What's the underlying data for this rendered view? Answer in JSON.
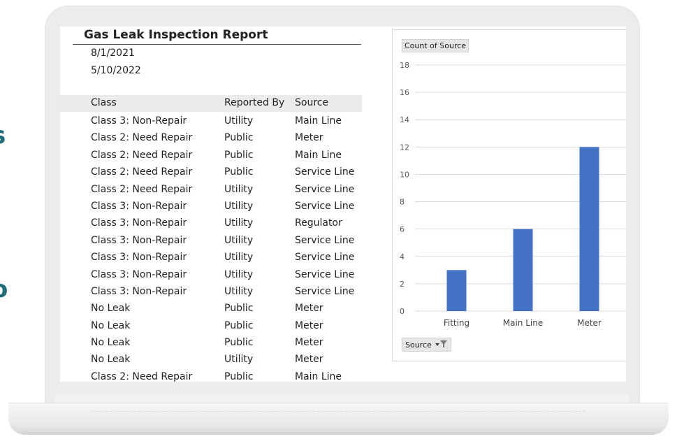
{
  "report": {
    "title": "Gas Leak Inspection Report",
    "date_start": "8/1/2021",
    "date_end": "5/10/2022",
    "columns": [
      "Class",
      "Reported By",
      "Source"
    ],
    "rows": [
      [
        "Class 3: Non-Repair",
        "Utility",
        "Main Line"
      ],
      [
        "Class 2: Need Repair",
        "Public",
        "Meter"
      ],
      [
        "Class 2: Need Repair",
        "Public",
        "Main Line"
      ],
      [
        "Class 2: Need Repair",
        "Public",
        "Service Line"
      ],
      [
        "Class 2: Need Repair",
        "Utility",
        "Service Line"
      ],
      [
        "Class 3: Non-Repair",
        "Utility",
        "Service Line"
      ],
      [
        "Class 3: Non-Repair",
        "Utility",
        "Regulator"
      ],
      [
        "Class 3: Non-Repair",
        "Utility",
        "Service Line"
      ],
      [
        "Class 3: Non-Repair",
        "Utility",
        "Service Line"
      ],
      [
        "Class 3: Non-Repair",
        "Utility",
        "Service Line"
      ],
      [
        "Class 3: Non-Repair",
        "Utility",
        "Service Line"
      ],
      [
        "No Leak",
        "Public",
        "Meter"
      ],
      [
        "No Leak",
        "Public",
        "Meter"
      ],
      [
        "No Leak",
        "Public",
        "Meter"
      ],
      [
        "No Leak",
        "Utility",
        "Meter"
      ],
      [
        "Class 2: Need Repair",
        "Public",
        "Main Line"
      ]
    ]
  },
  "chart_panel": {
    "value_field_label": "Count of Source",
    "axis_field_label": "Source",
    "filter_icon": "filter-dropdown-icon"
  },
  "chart_data": {
    "type": "bar",
    "categories": [
      "Fitting",
      "Main Line",
      "Meter"
    ],
    "values": [
      3,
      6,
      12
    ],
    "ylim": [
      0,
      18
    ],
    "yticks": [
      0,
      2,
      4,
      6,
      8,
      10,
      12,
      14,
      16,
      18
    ],
    "bar_color": "#4472c4",
    "grid": true,
    "legend": "none"
  },
  "colors": {
    "accent_text": "#1f6b78",
    "header_band": "#ebebeb",
    "gridline": "#d9d9d9"
  }
}
